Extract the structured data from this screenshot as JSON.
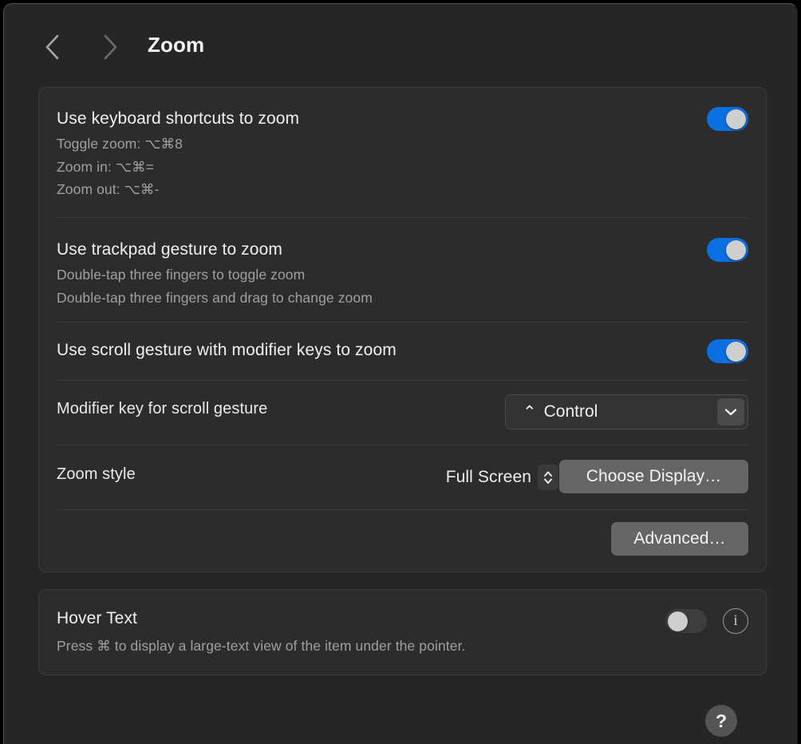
{
  "window": {
    "title": "Zoom",
    "background_color": "#262626",
    "group_color": "#2c2c2c",
    "accent_color": "#0a6fe0"
  },
  "toolbar": {
    "back_icon": "chevron-left-icon",
    "forward_icon": "chevron-right-icon",
    "title": "Zoom"
  },
  "zoom_group": {
    "keyboard_shortcuts": {
      "title": "Use keyboard shortcuts to zoom",
      "lines": [
        "Toggle zoom: ⌥⌘8",
        "Zoom in: ⌥⌘=",
        "Zoom out: ⌥⌘-"
      ],
      "toggle_state": "on"
    },
    "trackpad_gesture": {
      "title": "Use trackpad gesture to zoom",
      "lines": [
        "Double-tap three fingers to toggle zoom",
        "Double-tap three fingers and drag to change zoom"
      ],
      "toggle_state": "on"
    },
    "scroll_gesture": {
      "title": "Use scroll gesture with modifier keys to zoom",
      "toggle_state": "on"
    },
    "modifier_key": {
      "label": "Modifier key for scroll gesture",
      "value": "Control",
      "value_symbol": "⌃",
      "chevron_icon": "chevron-down-icon"
    },
    "zoom_style": {
      "label": "Zoom style",
      "value": "Full Screen",
      "stepper_icon": "up-down-chevron-icon",
      "choose_display_label": "Choose Display…"
    },
    "advanced": {
      "label": "Advanced…"
    }
  },
  "hover_text_group": {
    "title": "Hover Text",
    "description": "Press ⌘ to display a large-text view of the item under the pointer.",
    "toggle_state": "off",
    "info_icon_label": "i"
  },
  "help": {
    "label": "?"
  }
}
